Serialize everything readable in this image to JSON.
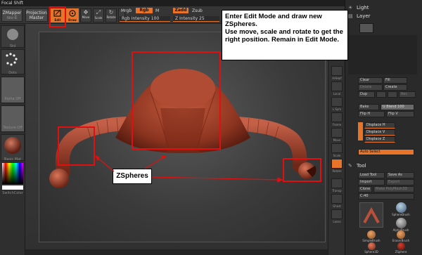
{
  "topbar": {
    "app_label": "Focal Shift"
  },
  "toolbar": {
    "zmapper_label": "ZMapper",
    "zmapper_sub": "rev-E",
    "projection_label": "Projection",
    "projection_sub": "Master",
    "edit_label": "Edit",
    "draw_label": "Draw",
    "move_label": "Move",
    "scale_label": "Scale",
    "rotate_label": "Rotate",
    "mrgb_label": "Mrgb",
    "rgb_label": "Rgb",
    "rgb_intensity_label": "Rgb Intensity 100",
    "zadd_label": "Zadd",
    "zsub_label": "Zsub",
    "z_intensity_label": "Z Intensity 25",
    "m_label": "M"
  },
  "leftshelf": {
    "brush_label": "Std",
    "stroke_label": "Dots",
    "alpha_label": "Alpha Off",
    "texture_label": "Texture Off",
    "material_label": "Basic Mat",
    "switch_color_label": "SwitchColor"
  },
  "rightcol": {
    "buttons": [
      "AAHalf",
      "Local",
      "L.Sym",
      "Frame",
      "Move",
      "Scale",
      "Rotate",
      "Transp",
      "Ghost",
      "Lasso"
    ]
  },
  "rightpanel": {
    "light_label": "Light",
    "layer_label": "Layer",
    "clear_label": "Clear",
    "fill_label": "Fill",
    "delete_label": "Delete",
    "create_label": "Create",
    "dup_label": "Dup",
    "rec_label": "Rec",
    "bake_label": "Bake",
    "u_blend_label": "U Blend 100",
    "flip_h_label": "Flip H",
    "flip_v_label": "Flip V",
    "displace_h_label": "Displace H",
    "displace_v_label": "Displace V",
    "displace_z_label": "Displace Z",
    "auto_select_label": "Auto Select",
    "tool_label": "Tool",
    "load_tool_label": "Load Tool",
    "save_as_label": "Save As",
    "import_label": "Import",
    "export_label": "Export",
    "clone_label": "Clone",
    "make_polymesh_label": "Make PolyMesh3D",
    "tool_value": "C:40",
    "tools": [
      "SphereBrush",
      "AlphaBrush",
      "SimpleBrush",
      "EraserBrush",
      "Sphere3D",
      "ZSphere"
    ]
  },
  "annotations": {
    "instruction": "Enter Edit Mode and draw new ZSpheres.\nUse move, scale and rotate to get the right position. Remain in Edit Mode.",
    "zspheres_label": "ZSpheres"
  },
  "colors": {
    "accent": "#e8742a",
    "annotation_red": "#e01010",
    "model_red": "#a8442c"
  }
}
